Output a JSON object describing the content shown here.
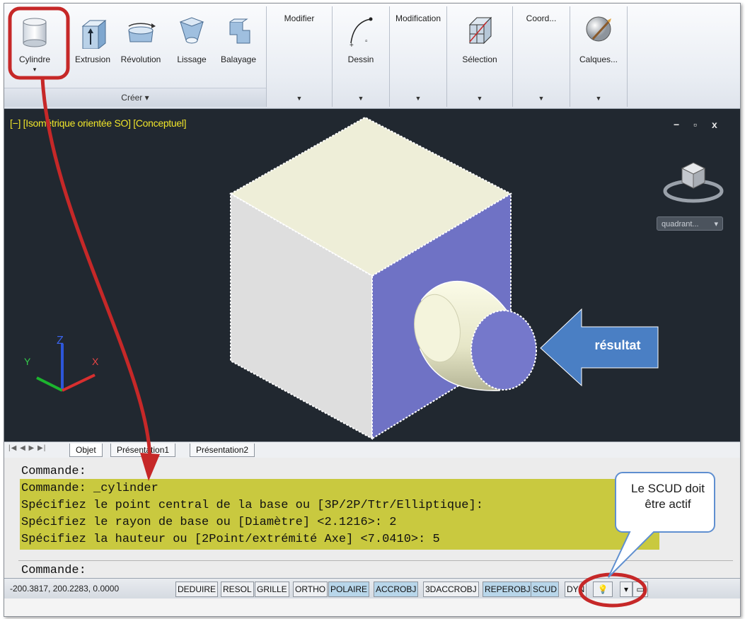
{
  "ribbon": {
    "creer_tools": [
      {
        "label": "Cylindre",
        "icon": "cylinder-icon"
      },
      {
        "label": "Extrusion",
        "icon": "extrusion-icon"
      },
      {
        "label": "Révolution",
        "icon": "revolution-icon"
      },
      {
        "label": "Lissage",
        "icon": "loft-icon"
      },
      {
        "label": "Balayage",
        "icon": "sweep-icon"
      }
    ],
    "creer_panel": "Créer",
    "modifier_panel": "Modifier",
    "dessin_label": "Dessin",
    "modification_panel": "Modification",
    "selection_label": "Sélection",
    "coord_panel": "Coord...",
    "calques_label": "Calques..."
  },
  "viewport": {
    "label": "[−] [Isométrique orientée SO] [Conceptuel]",
    "controls": [
      "−",
      "▫",
      "x"
    ],
    "viewcube_dropdown": "quadrant...",
    "ucs_axes": {
      "x": "X",
      "y": "Y",
      "z": "Z"
    }
  },
  "tabs": {
    "nav": "|◀ ◀ ▶ ▶|",
    "items": [
      "Objet",
      "Présentation1",
      "Présentation2"
    ],
    "active": "Objet"
  },
  "command": {
    "lines": [
      "Commande:",
      "Commande: _cylinder",
      "Spécifiez le point central de la base ou [3P/2P/Ttr/Elliptique]:",
      "Spécifiez le rayon de base ou [Diamètre] <2.1216>: 2",
      "Spécifiez la hauteur ou [2Point/extrémité Axe] <7.0410>: 5"
    ],
    "prompt": "Commande:"
  },
  "statusbar": {
    "coords": "-200.3817, 200.2283, 0.0000",
    "buttons": [
      {
        "label": "DEDUIRE",
        "on": false
      },
      {
        "label": "RESOL",
        "on": false
      },
      {
        "label": "GRILLE",
        "on": false
      },
      {
        "label": "ORTHO",
        "on": false
      },
      {
        "label": "POLAIRE",
        "on": true
      },
      {
        "label": "ACCROBJ",
        "on": true
      },
      {
        "label": "3DACCROBJ",
        "on": false
      },
      {
        "label": "REPEROBJ",
        "on": true
      },
      {
        "label": "SCUD",
        "on": true
      },
      {
        "label": "DYN",
        "on": false
      }
    ]
  },
  "annotations": {
    "callout": "Le SCUD doit être actif",
    "result": "résultat",
    "highlight_color": "#c62828",
    "arrow_color": "#4a7fc4"
  }
}
